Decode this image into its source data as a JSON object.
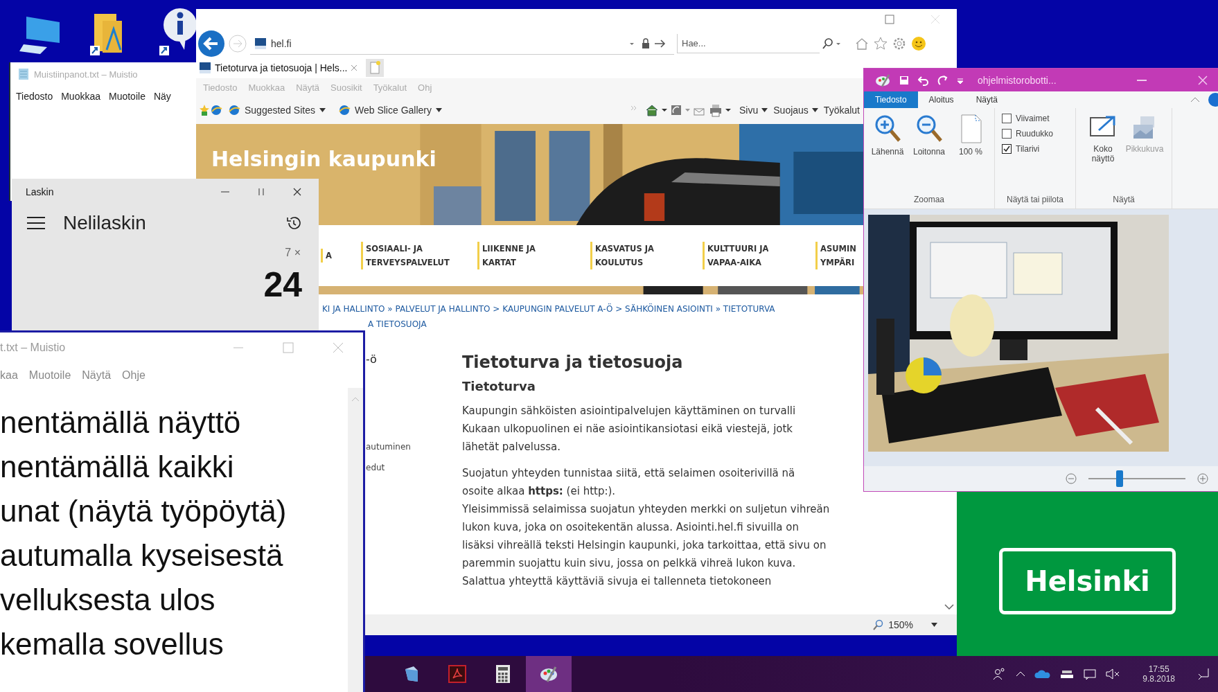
{
  "notepad_back": {
    "title": "Muistiinpanot.txt – Muistio",
    "menu": [
      "Tiedosto",
      "Muokkaa",
      "Muotoile",
      "Näy"
    ]
  },
  "browser": {
    "address": "hel.fi",
    "search": {
      "placeholder": "Hae..."
    },
    "tab": {
      "title": "Tietoturva ja tietosuoja | Hels..."
    },
    "menu": [
      "Tiedosto",
      "Muokkaa",
      "Näytä",
      "Suosikit",
      "Työkalut",
      "Ohj"
    ],
    "favorites": [
      "Suggested Sites",
      "Web Slice Gallery"
    ],
    "commands": [
      "Sivu",
      "Suojaus",
      "Työkalut"
    ],
    "page": {
      "banner_title": "Helsingin kaupunki",
      "nav": [
        {
          "lines": [
            "A"
          ]
        },
        {
          "lines": [
            "SOSIAALI- JA",
            "TERVEYSPALVELUT"
          ]
        },
        {
          "lines": [
            "LIIKENNE JA",
            "KARTAT"
          ]
        },
        {
          "lines": [
            "KASVATUS JA",
            "KOULUTUS"
          ]
        },
        {
          "lines": [
            "KULTTUURI JA",
            "VAPAA-AIKA"
          ]
        },
        {
          "lines": [
            "ASUMIN",
            "YMPÄRI"
          ]
        }
      ],
      "breadcrumb": [
        "KI JA HALLINTO » PALVELUT JA HALLINTO > KAUPUNGIN PALVELUT A-Ö > SÄHKÖINEN ASIOINTI » TIETOTURVA",
        "A TIETOSUOJA"
      ],
      "sidebar": [
        "-ö",
        "autuminen",
        "edut"
      ],
      "heading": "Tietoturva ja tietosuoja",
      "subheading": "Tietoturva",
      "paragraphs": [
        {
          "lines": [
            "Kaupungin sähköisten asiointipalvelujen käyttäminen on turvalli",
            "Kukaan ulkopuolinen ei näe asiointikansiotasi eikä viestejä, jotk",
            "lähetät palvelussa."
          ]
        },
        {
          "lines": [
            "Suojatun yhteyden tunnistaa siitä, että selaimen osoiterivillä nä",
            "osoite alkaa **https:** (ei http:).",
            "Yleisimmissä selaimissa suojatun yhteyden merkki on suljetun vihreän",
            "lukon kuva, joka on osoitekentän alussa. Asiointi.hel.fi  sivuilla on",
            "lisäksi vihreällä teksti Helsingin kaupunki, joka tarkoittaa, että sivu on",
            "paremmin suojattu kuin sivu, jossa on pelkkä vihreä lukon kuva.",
            "Salattua yhteyttä käyttäviä sivuja ei tallenneta tietokoneen"
          ]
        }
      ]
    },
    "status_zoom": "150%"
  },
  "calculator": {
    "title": "Laskin",
    "mode": "Nelilaskin",
    "expression": "7 ×",
    "result": "24"
  },
  "notepad_front": {
    "title": "t.txt – Muistio",
    "menu": [
      "kaa",
      "Muotoile",
      "Näytä",
      "Ohje"
    ],
    "lines": [
      "nentämällä näyttö",
      "nentämällä kaikki",
      "unat (näytä työpöytä)",
      "autumalla kyseisestä",
      "velluksesta ulos",
      "kemalla  sovellus"
    ]
  },
  "viewer": {
    "title": "ohjelmistorobotti...",
    "tabs": [
      {
        "label": "Tiedosto",
        "selected": true
      },
      {
        "label": "Aloitus",
        "selected": false
      },
      {
        "label": "Näytä",
        "selected": false
      }
    ],
    "zoom_buttons": [
      "Lähennä",
      "Loitonna",
      "100 %"
    ],
    "checkboxes": [
      {
        "label": "Viivaimet",
        "checked": false
      },
      {
        "label": "Ruudukko",
        "checked": false
      },
      {
        "label": "Tilarivi",
        "checked": true
      }
    ],
    "view_buttons": [
      "Koko näyttö",
      "Pikkukuva"
    ],
    "groups": [
      "Zoomaa",
      "Näytä tai piilota",
      "Näytä"
    ],
    "zoom": {
      "level": 0.33
    }
  },
  "logo": "Helsinki",
  "taskbar": {
    "apps": [
      {
        "selected": false
      },
      {
        "selected": false
      },
      {
        "selected": false
      },
      {
        "selected": true
      }
    ],
    "time": "17:55",
    "date": "9.8.2018"
  }
}
